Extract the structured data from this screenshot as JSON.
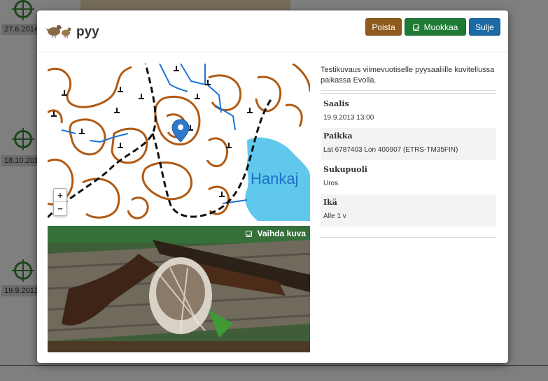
{
  "background": {
    "timeline": [
      {
        "date": "27.6.2014"
      },
      {
        "date": "18.10.2013"
      },
      {
        "date": "19.9.2013"
      }
    ]
  },
  "modal": {
    "title": "pyy",
    "species_icon": "grouse-icon",
    "buttons": {
      "delete": "Poista",
      "edit": "Muokkaa",
      "close": "Sulje"
    },
    "map": {
      "zoom_in": "+",
      "zoom_out": "−",
      "lake_label": "Hankaj",
      "colors": {
        "contour": "#b05a14",
        "water": "#5fc8ec",
        "stream": "#1e74d4",
        "road": "#111111",
        "marker": "#2e79c7"
      }
    },
    "photo": {
      "change_label": "Vaihda kuva"
    },
    "description": "Testikuvaus viimevuotiselle pyysaaliille kuvitellussa paikassa Evolla.",
    "fields": [
      {
        "label": "Saalis",
        "value": "19.9.2013 13:00"
      },
      {
        "label": "Paikka",
        "value": "Lat 6787403 Lon 400907 (ETRS-TM35FIN)"
      },
      {
        "label": "Sukupuoli",
        "value": "Uros"
      },
      {
        "label": "Ikä",
        "value": "Alle 1 v"
      }
    ]
  }
}
